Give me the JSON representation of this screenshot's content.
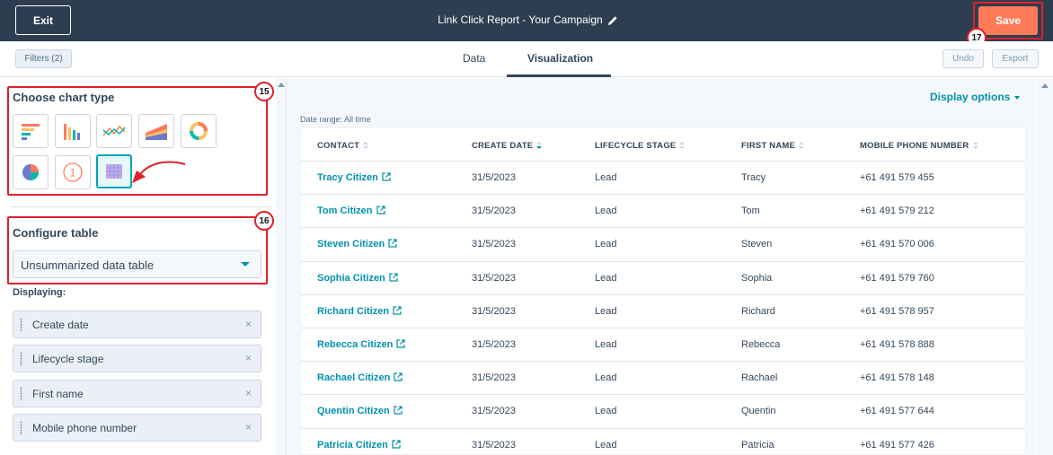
{
  "header": {
    "exit_label": "Exit",
    "report_title": "Link Click Report - Your Campaign",
    "save_label": "Save"
  },
  "annotations": [
    "15",
    "16",
    "17"
  ],
  "toolbar": {
    "filters_label": "Filters (2)",
    "tabs": [
      "Data",
      "Visualization"
    ],
    "active_tab": "Visualization",
    "undo_label": "Undo",
    "export_label": "Export"
  },
  "left_panel": {
    "chart_type_title": "Choose chart type",
    "chart_types": [
      "horizontal-bar-chart-icon",
      "vertical-bar-chart-icon",
      "line-chart-icon",
      "area-chart-icon",
      "donut-chart-icon",
      "pie-chart-icon",
      "summary-number-icon",
      "data-table-icon"
    ],
    "summary_number_glyph": "1",
    "selected_chart_type": "data-table-icon",
    "configure_title": "Configure table",
    "table_mode": "Unsummarized data table",
    "displaying_label": "Displaying:",
    "fields": [
      "Create date",
      "Lifecycle stage",
      "First name",
      "Mobile phone number"
    ],
    "remove_glyph": "×"
  },
  "right_panel": {
    "display_options_label": "Display options",
    "date_range": "Date range: All time",
    "columns": [
      "CONTACT",
      "CREATE DATE",
      "LIFECYCLE STAGE",
      "FIRST NAME",
      "MOBILE PHONE NUMBER"
    ],
    "sorted_column": "CREATE DATE",
    "rows": [
      [
        "Tracy Citizen",
        "31/5/2023",
        "Lead",
        "Tracy",
        "+61 491 579 455"
      ],
      [
        "Tom Citizen",
        "31/5/2023",
        "Lead",
        "Tom",
        "+61 491 579 212"
      ],
      [
        "Steven Citizen",
        "31/5/2023",
        "Lead",
        "Steven",
        "+61 491 570 006"
      ],
      [
        "Sophia Citizen",
        "31/5/2023",
        "Lead",
        "Sophia",
        "+61 491 579 760"
      ],
      [
        "Richard Citizen",
        "31/5/2023",
        "Lead",
        "Richard",
        "+61 491 578 957"
      ],
      [
        "Rebecca Citizen",
        "31/5/2023",
        "Lead",
        "Rebecca",
        "+61 491 578 888"
      ],
      [
        "Rachael Citizen",
        "31/5/2023",
        "Lead",
        "Rachael",
        "+61 491 578 148"
      ],
      [
        "Quentin Citizen",
        "31/5/2023",
        "Lead",
        "Quentin",
        "+61 491 577 644"
      ],
      [
        "Patricia Citizen",
        "31/5/2023",
        "Lead",
        "Patricia",
        "+61 491 577 426"
      ]
    ]
  },
  "colors": {
    "topbar": "#2d3e50",
    "save_button": "#ff7a59",
    "link": "#0091ae",
    "annotation_red": "#e0202a"
  }
}
